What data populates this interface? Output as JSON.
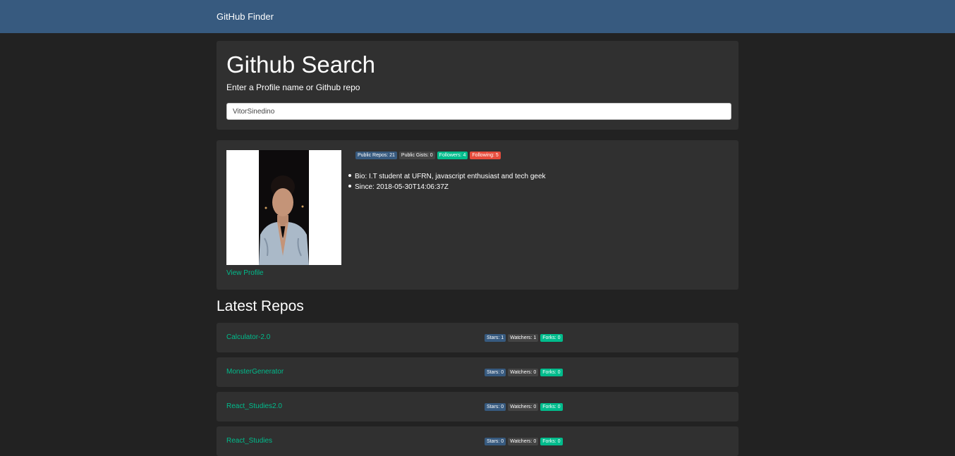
{
  "navbar": {
    "brand": "GitHub Finder"
  },
  "search": {
    "title": "Github Search",
    "subtitle": "Enter a Profile name or Github repo",
    "value": "VitorSinedino"
  },
  "profile": {
    "view_profile": "View Profile",
    "badges": {
      "public_repos": "Public Repos: 21",
      "public_gists": "Public Gists: 0",
      "followers": "Followers: 4",
      "following": "Following: 5"
    },
    "bio": "Bio: I.T student at UFRN, javascript enthusiast and tech geek",
    "since": "Since: 2018-05-30T14:06:37Z"
  },
  "latest_repos_title": "Latest Repos",
  "repos": [
    {
      "name": "Calculator-2.0",
      "stars": "Stars: 1",
      "watchers": "Watchers: 1",
      "forks": "Forks: 0"
    },
    {
      "name": "MonsterGenerator",
      "stars": "Stars: 0",
      "watchers": "Watchers: 0",
      "forks": "Forks: 0"
    },
    {
      "name": "React_Studies2.0",
      "stars": "Stars: 0",
      "watchers": "Watchers: 0",
      "forks": "Forks: 0"
    },
    {
      "name": "React_Studies",
      "stars": "Stars: 0",
      "watchers": "Watchers: 0",
      "forks": "Forks: 0"
    }
  ],
  "colors": {
    "navbar": "#375a7f",
    "background": "#222222",
    "card": "#303030",
    "link": "#00bc8c",
    "badge_primary": "#375a7f",
    "badge_secondary": "#444444",
    "badge_success": "#00bc8c",
    "badge_danger": "#e74c3c"
  }
}
